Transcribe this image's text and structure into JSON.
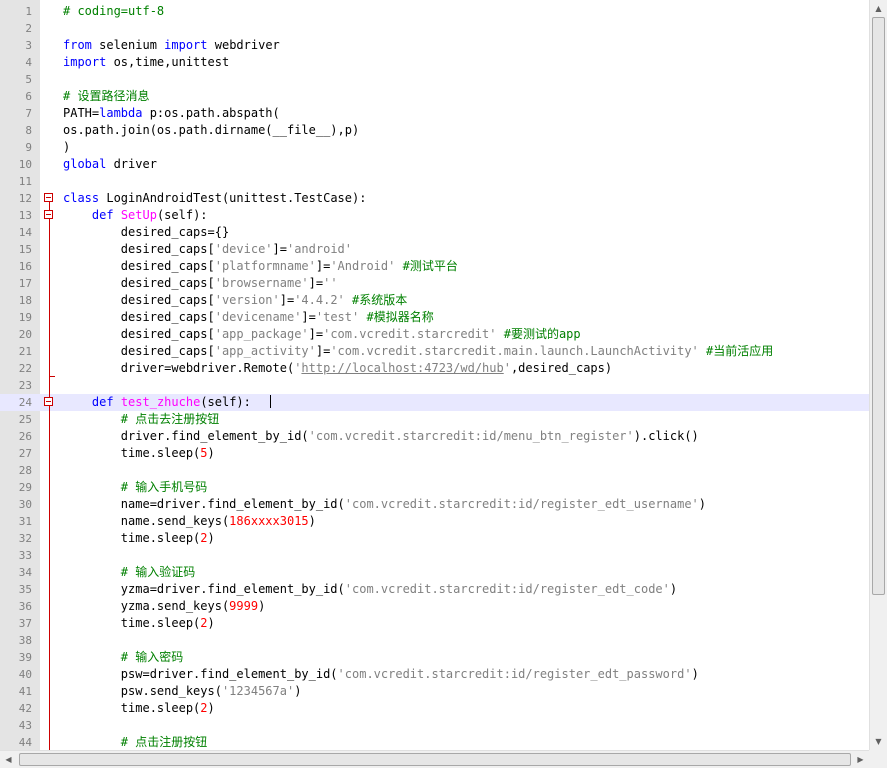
{
  "editor": {
    "current_line": 24,
    "lines": [
      {
        "n": "1",
        "tokens": [
          [
            "cm",
            "# coding=utf-8"
          ]
        ]
      },
      {
        "n": "2",
        "tokens": []
      },
      {
        "n": "3",
        "tokens": [
          [
            "kw",
            "from"
          ],
          [
            "txt",
            " selenium "
          ],
          [
            "kw",
            "import"
          ],
          [
            "txt",
            " webdriver"
          ]
        ]
      },
      {
        "n": "4",
        "tokens": [
          [
            "kw",
            "import"
          ],
          [
            "txt",
            " os,time,unittest"
          ]
        ]
      },
      {
        "n": "5",
        "tokens": []
      },
      {
        "n": "6",
        "tokens": [
          [
            "cm",
            "# 设置路径消息"
          ]
        ]
      },
      {
        "n": "7",
        "tokens": [
          [
            "txt",
            "PATH="
          ],
          [
            "kw",
            "lambda"
          ],
          [
            "txt",
            " p:os.path.abspath("
          ]
        ]
      },
      {
        "n": "8",
        "tokens": [
          [
            "txt",
            "os.path.join(os.path.dirname(__file__),p)"
          ]
        ]
      },
      {
        "n": "9",
        "tokens": [
          [
            "txt",
            ")"
          ]
        ]
      },
      {
        "n": "10",
        "tokens": [
          [
            "kw",
            "global"
          ],
          [
            "txt",
            " driver"
          ]
        ]
      },
      {
        "n": "11",
        "tokens": []
      },
      {
        "n": "12",
        "tokens": [
          [
            "def",
            "class"
          ],
          [
            "txt",
            " LoginAndroidTest(unittest.TestCase):"
          ]
        ]
      },
      {
        "n": "13",
        "tokens": [
          [
            "txt",
            "    "
          ],
          [
            "def",
            "def"
          ],
          [
            "txt",
            " "
          ],
          [
            "fn",
            "SetUp"
          ],
          [
            "txt",
            "(self):"
          ]
        ]
      },
      {
        "n": "14",
        "tokens": [
          [
            "txt",
            "        desired_caps={}"
          ]
        ]
      },
      {
        "n": "15",
        "tokens": [
          [
            "txt",
            "        desired_caps["
          ],
          [
            "str",
            "'device'"
          ],
          [
            "txt",
            "]="
          ],
          [
            "str",
            "'android'"
          ]
        ]
      },
      {
        "n": "16",
        "tokens": [
          [
            "txt",
            "        desired_caps["
          ],
          [
            "str",
            "'platformname'"
          ],
          [
            "txt",
            "]="
          ],
          [
            "str",
            "'Android'"
          ],
          [
            "txt",
            " "
          ],
          [
            "cm",
            "#测试平台"
          ]
        ]
      },
      {
        "n": "17",
        "tokens": [
          [
            "txt",
            "        desired_caps["
          ],
          [
            "str",
            "'browsername'"
          ],
          [
            "txt",
            "]="
          ],
          [
            "str",
            "''"
          ]
        ]
      },
      {
        "n": "18",
        "tokens": [
          [
            "txt",
            "        desired_caps["
          ],
          [
            "str",
            "'version'"
          ],
          [
            "txt",
            "]="
          ],
          [
            "str",
            "'4.4.2'"
          ],
          [
            "txt",
            " "
          ],
          [
            "cm",
            "#系统版本"
          ]
        ]
      },
      {
        "n": "19",
        "tokens": [
          [
            "txt",
            "        desired_caps["
          ],
          [
            "str",
            "'devicename'"
          ],
          [
            "txt",
            "]="
          ],
          [
            "str",
            "'test'"
          ],
          [
            "txt",
            " "
          ],
          [
            "cm",
            "#模拟器名称"
          ]
        ]
      },
      {
        "n": "20",
        "tokens": [
          [
            "txt",
            "        desired_caps["
          ],
          [
            "str",
            "'app_package'"
          ],
          [
            "txt",
            "]="
          ],
          [
            "str",
            "'com.vcredit.starcredit'"
          ],
          [
            "txt",
            " "
          ],
          [
            "cm",
            "#要测试的app"
          ]
        ]
      },
      {
        "n": "21",
        "tokens": [
          [
            "txt",
            "        desired_caps["
          ],
          [
            "str",
            "'app_activity'"
          ],
          [
            "txt",
            "]="
          ],
          [
            "str",
            "'com.vcredit.starcredit.main.launch.LaunchActivity'"
          ],
          [
            "txt",
            " "
          ],
          [
            "cm",
            "#当前活应用"
          ]
        ]
      },
      {
        "n": "22",
        "tokens": [
          [
            "txt",
            "        driver=webdriver.Remote("
          ],
          [
            "str",
            "'"
          ],
          [
            "url",
            "http://localhost:4723/wd/hub"
          ],
          [
            "str",
            "'"
          ],
          [
            "txt",
            ",desired_caps)"
          ]
        ]
      },
      {
        "n": "23",
        "tokens": []
      },
      {
        "n": "24",
        "tokens": [
          [
            "txt",
            "    "
          ],
          [
            "def",
            "def"
          ],
          [
            "txt",
            " "
          ],
          [
            "fn",
            "test_zhuche"
          ],
          [
            "txt",
            "(self):"
          ]
        ]
      },
      {
        "n": "25",
        "tokens": [
          [
            "txt",
            "        "
          ],
          [
            "cm",
            "# 点击去注册按钮"
          ]
        ]
      },
      {
        "n": "26",
        "tokens": [
          [
            "txt",
            "        driver.find_element_by_id("
          ],
          [
            "str",
            "'com.vcredit.starcredit:id/menu_btn_register'"
          ],
          [
            "txt",
            ").click()"
          ]
        ]
      },
      {
        "n": "27",
        "tokens": [
          [
            "txt",
            "        time.sleep("
          ],
          [
            "num",
            "5"
          ],
          [
            "txt",
            ")"
          ]
        ]
      },
      {
        "n": "28",
        "tokens": []
      },
      {
        "n": "29",
        "tokens": [
          [
            "txt",
            "        "
          ],
          [
            "cm",
            "# 输入手机号码"
          ]
        ]
      },
      {
        "n": "30",
        "tokens": [
          [
            "txt",
            "        name=driver.find_element_by_id("
          ],
          [
            "str",
            "'com.vcredit.starcredit:id/register_edt_username'"
          ],
          [
            "txt",
            ")"
          ]
        ]
      },
      {
        "n": "31",
        "tokens": [
          [
            "txt",
            "        name.send_keys("
          ],
          [
            "num",
            "186xxxx3015"
          ],
          [
            "txt",
            ")"
          ]
        ]
      },
      {
        "n": "32",
        "tokens": [
          [
            "txt",
            "        time.sleep("
          ],
          [
            "num",
            "2"
          ],
          [
            "txt",
            ")"
          ]
        ]
      },
      {
        "n": "33",
        "tokens": []
      },
      {
        "n": "34",
        "tokens": [
          [
            "txt",
            "        "
          ],
          [
            "cm",
            "# 输入验证码"
          ]
        ]
      },
      {
        "n": "35",
        "tokens": [
          [
            "txt",
            "        yzma=driver.find_element_by_id("
          ],
          [
            "str",
            "'com.vcredit.starcredit:id/register_edt_code'"
          ],
          [
            "txt",
            ")"
          ]
        ]
      },
      {
        "n": "36",
        "tokens": [
          [
            "txt",
            "        yzma.send_keys("
          ],
          [
            "num",
            "9999"
          ],
          [
            "txt",
            ")"
          ]
        ]
      },
      {
        "n": "37",
        "tokens": [
          [
            "txt",
            "        time.sleep("
          ],
          [
            "num",
            "2"
          ],
          [
            "txt",
            ")"
          ]
        ]
      },
      {
        "n": "38",
        "tokens": []
      },
      {
        "n": "39",
        "tokens": [
          [
            "txt",
            "        "
          ],
          [
            "cm",
            "# 输入密码"
          ]
        ]
      },
      {
        "n": "40",
        "tokens": [
          [
            "txt",
            "        psw=driver.find_element_by_id("
          ],
          [
            "str",
            "'com.vcredit.starcredit:id/register_edt_password'"
          ],
          [
            "txt",
            ")"
          ]
        ]
      },
      {
        "n": "41",
        "tokens": [
          [
            "txt",
            "        psw.send_keys("
          ],
          [
            "str",
            "'1234567a'"
          ],
          [
            "txt",
            ")"
          ]
        ]
      },
      {
        "n": "42",
        "tokens": [
          [
            "txt",
            "        time.sleep("
          ],
          [
            "num",
            "2"
          ],
          [
            "txt",
            ")"
          ]
        ]
      },
      {
        "n": "43",
        "tokens": []
      },
      {
        "n": "44",
        "tokens": [
          [
            "txt",
            "        "
          ],
          [
            "cm",
            "# 点击注册按钮"
          ]
        ]
      }
    ]
  },
  "scrollbars": {
    "up_arrow": "▲",
    "down_arrow": "▼",
    "left_arrow": "◀",
    "right_arrow": "▶"
  },
  "colors": {
    "keyword": "#0000ff",
    "function_name": "#ff00ff",
    "string": "#808080",
    "number": "#ff0000",
    "comment": "#008000",
    "current_line": "#e8e8ff",
    "fold_marker": "#cc0000"
  }
}
